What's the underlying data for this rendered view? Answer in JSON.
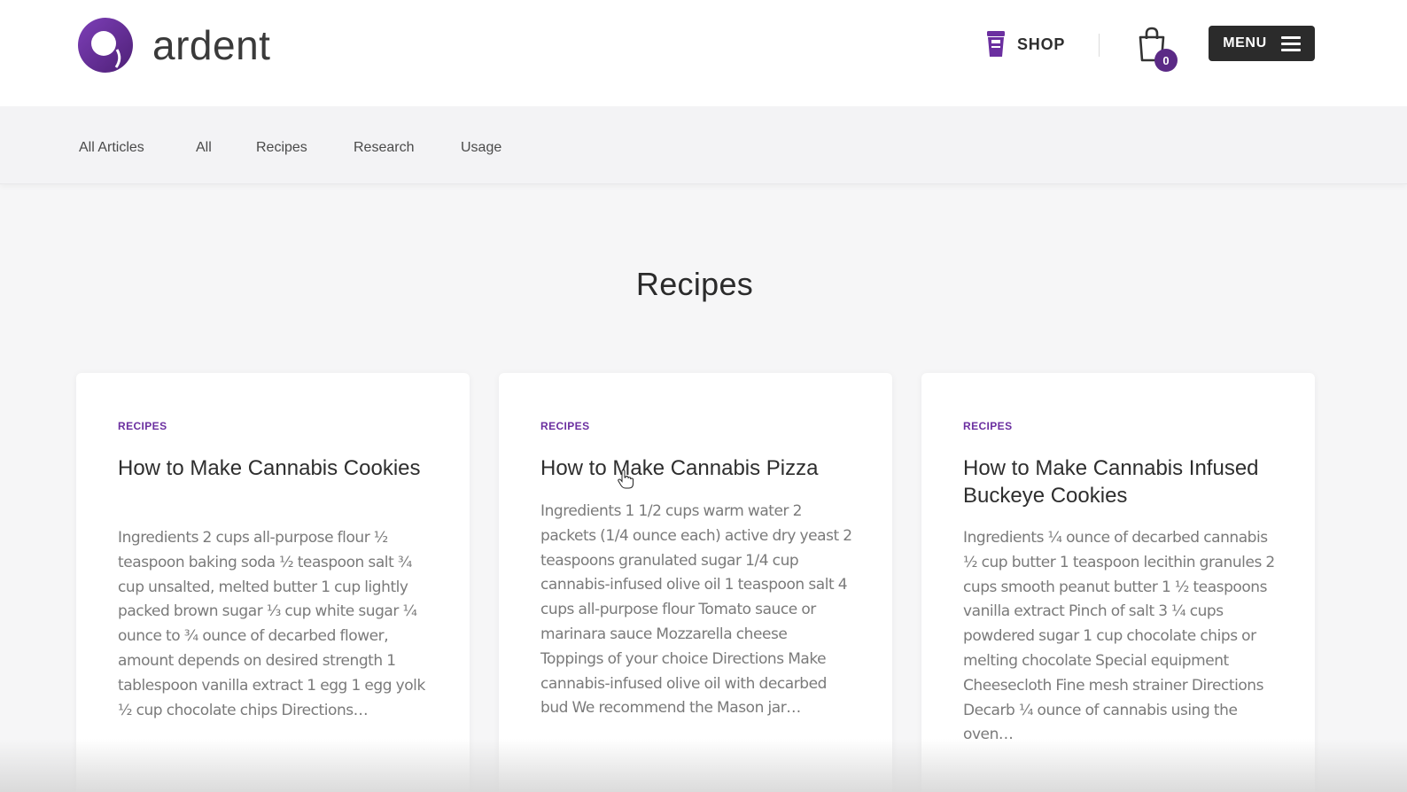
{
  "brand": {
    "name": "ardent",
    "accent_color": "#5b2a86",
    "logo_icon": "ardent-ring-logo"
  },
  "header": {
    "shop_label": "SHOP",
    "shop_icon": "cup-icon",
    "cart_icon": "shopping-bag-icon",
    "cart_count": "0",
    "menu_label": "MENU",
    "menu_icon": "hamburger-icon"
  },
  "subnav": {
    "items": [
      "All Articles",
      "All",
      "Recipes",
      "Research",
      "Usage"
    ]
  },
  "page": {
    "title": "Recipes"
  },
  "cards": [
    {
      "category": "RECIPES",
      "title": "How to Make Cannabis Cookies",
      "excerpt": "Ingredients 2 cups all-purpose flour ½ teaspoon baking soda ½ teaspoon salt ¾ cup unsalted, melted butter 1 cup lightly packed brown sugar ⅓ cup white sugar ¼ ounce to ¾ ounce of decarbed flower, amount depends on desired strength 1 tablespoon vanilla extract 1 egg 1 egg yolk ½ cup chocolate chips   Directions…"
    },
    {
      "category": "RECIPES",
      "title": "How to Make Cannabis Pizza",
      "excerpt": "Ingredients 1 1/2 cups warm water 2 packets (1/4 ounce each) active dry yeast 2 teaspoons granulated sugar 1/4 cup cannabis-infused olive oil 1 teaspoon salt 4 cups all-purpose flour Tomato sauce or marinara sauce Mozzarella cheese Toppings of your choice   Directions Make cannabis-infused olive oil with decarbed bud We recommend the Mason jar…"
    },
    {
      "category": "RECIPES",
      "title": "How to Make Cannabis Infused Buckeye Cookies",
      "excerpt": "Ingredients ¼ ounce of decarbed cannabis ½ cup butter 1 teaspoon lecithin granules 2 cups smooth peanut butter 1 ½ teaspoons vanilla extract Pinch of salt 3 ¼ cups powdered sugar 1 cup chocolate chips or melting chocolate   Special equipment Cheesecloth Fine mesh strainer   Directions Decarb ¼ ounce of cannabis using the oven…"
    }
  ]
}
